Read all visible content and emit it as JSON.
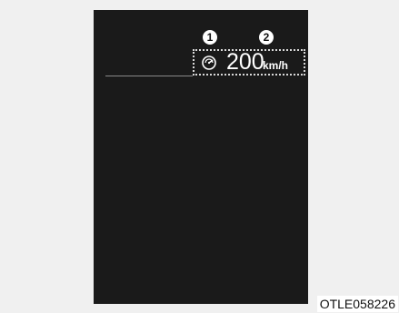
{
  "display": {
    "markers": [
      "1",
      "2"
    ],
    "speed_icon": "speedometer-icon",
    "speed": {
      "value": "200",
      "unit": "km/h"
    }
  },
  "caption": "OTLE058226"
}
